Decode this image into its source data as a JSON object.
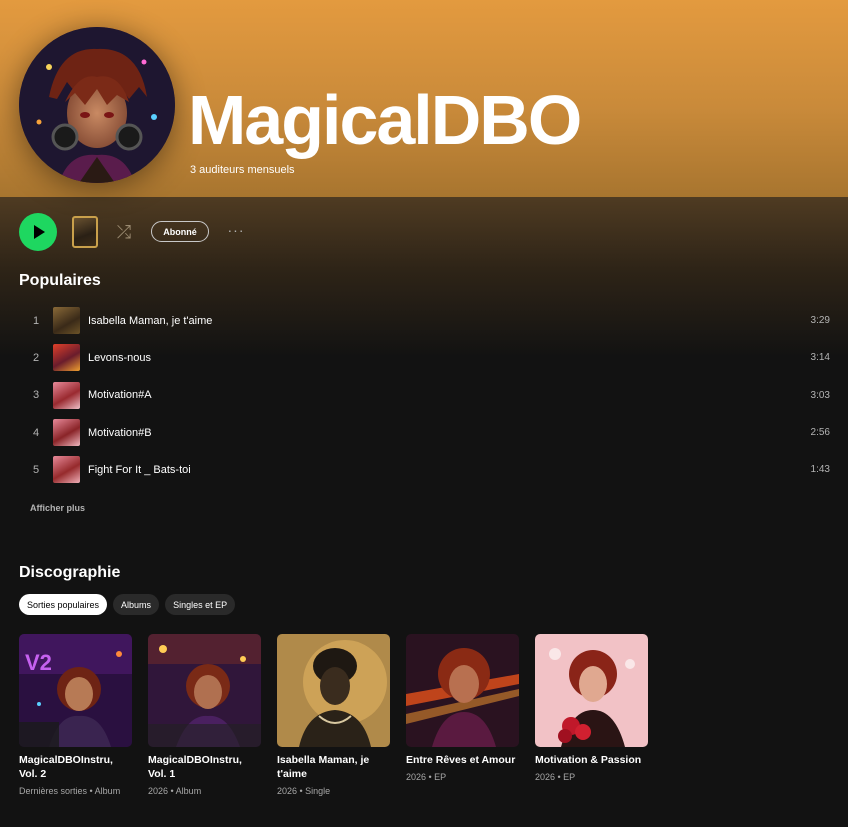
{
  "artist": {
    "name": "MagicalDBO",
    "listeners": "3 auditeurs mensuels"
  },
  "controls": {
    "follow_label": "Abonné",
    "more_label": "···",
    "shuffle_icon": "shuffle-icon",
    "play_icon": "play-icon"
  },
  "colors": {
    "accent": "#1ed760",
    "header_top": "#e39a3f",
    "background": "#121212"
  },
  "popular": {
    "title": "Populaires",
    "show_more": "Afficher plus",
    "tracks": [
      {
        "num": "1",
        "title": "Isabella Maman, je t'aime",
        "duration": "3:29"
      },
      {
        "num": "2",
        "title": "Levons-nous",
        "duration": "3:14"
      },
      {
        "num": "3",
        "title": "Motivation#A",
        "duration": "3:03"
      },
      {
        "num": "4",
        "title": "Motivation#B",
        "duration": "2:56"
      },
      {
        "num": "5",
        "title": "Fight For It _ Bats-toi",
        "duration": "1:43"
      }
    ]
  },
  "discography": {
    "title": "Discographie",
    "filters": [
      "Sorties populaires",
      "Albums",
      "Singles et EP"
    ],
    "active_filter": "Sorties populaires",
    "releases": [
      {
        "title": "MagicalDBOInstru, Vol. 2",
        "subtitle": "Dernières sorties • Album"
      },
      {
        "title": "MagicalDBOInstru, Vol. 1",
        "subtitle": "2026 • Album"
      },
      {
        "title": "Isabella Maman, je t'aime",
        "subtitle": "2026 • Single"
      },
      {
        "title": "Entre Rêves et Amour",
        "subtitle": "2026 • EP"
      },
      {
        "title": "Motivation & Passion",
        "subtitle": "2026 • EP"
      }
    ]
  }
}
